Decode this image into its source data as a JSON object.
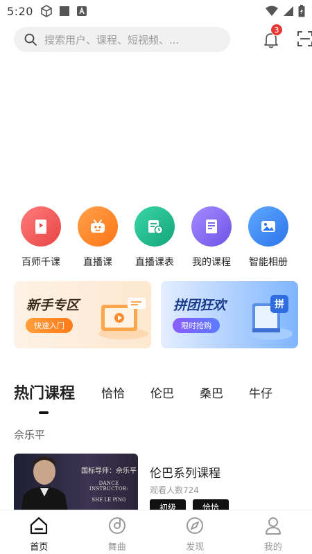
{
  "status": {
    "time": "5:20"
  },
  "search": {
    "placeholder": "搜索用户、课程、短视频、..."
  },
  "notifications": {
    "count": "3"
  },
  "quick_links": [
    {
      "label": "百师千课",
      "icon": "video-book-icon",
      "color": "#f05a5a"
    },
    {
      "label": "直播课",
      "icon": "live-tv-icon",
      "color": "#ff8a2b"
    },
    {
      "label": "直播课表",
      "icon": "schedule-icon",
      "color": "#1fbf8f"
    },
    {
      "label": "我的课程",
      "icon": "course-list-icon",
      "color": "#8a6cf0"
    },
    {
      "label": "智能相册",
      "icon": "photo-album-icon",
      "color": "#3d8ef5"
    }
  ],
  "promos": [
    {
      "title": "新手专区",
      "button": "快速入门"
    },
    {
      "title": "拼团狂欢",
      "button": "限时抢购",
      "badge": "拼"
    }
  ],
  "course_tabs": [
    "热门课程",
    "恰恰",
    "伦巴",
    "桑巴",
    "牛仔"
  ],
  "teacher": "佘乐平",
  "course": {
    "title": "伦巴系列课程",
    "views": "观看人数724",
    "tags": [
      "初级",
      "恰恰"
    ],
    "thumb_text": [
      "国标导师：佘乐平",
      "DANCE INSTRUCTOR:",
      "SHE LE PING"
    ]
  },
  "tabbar": [
    {
      "label": "首页",
      "icon": "home-icon"
    },
    {
      "label": "舞曲",
      "icon": "music-disc-icon"
    },
    {
      "label": "发现",
      "icon": "compass-icon"
    },
    {
      "label": "我的",
      "icon": "profile-icon"
    }
  ]
}
